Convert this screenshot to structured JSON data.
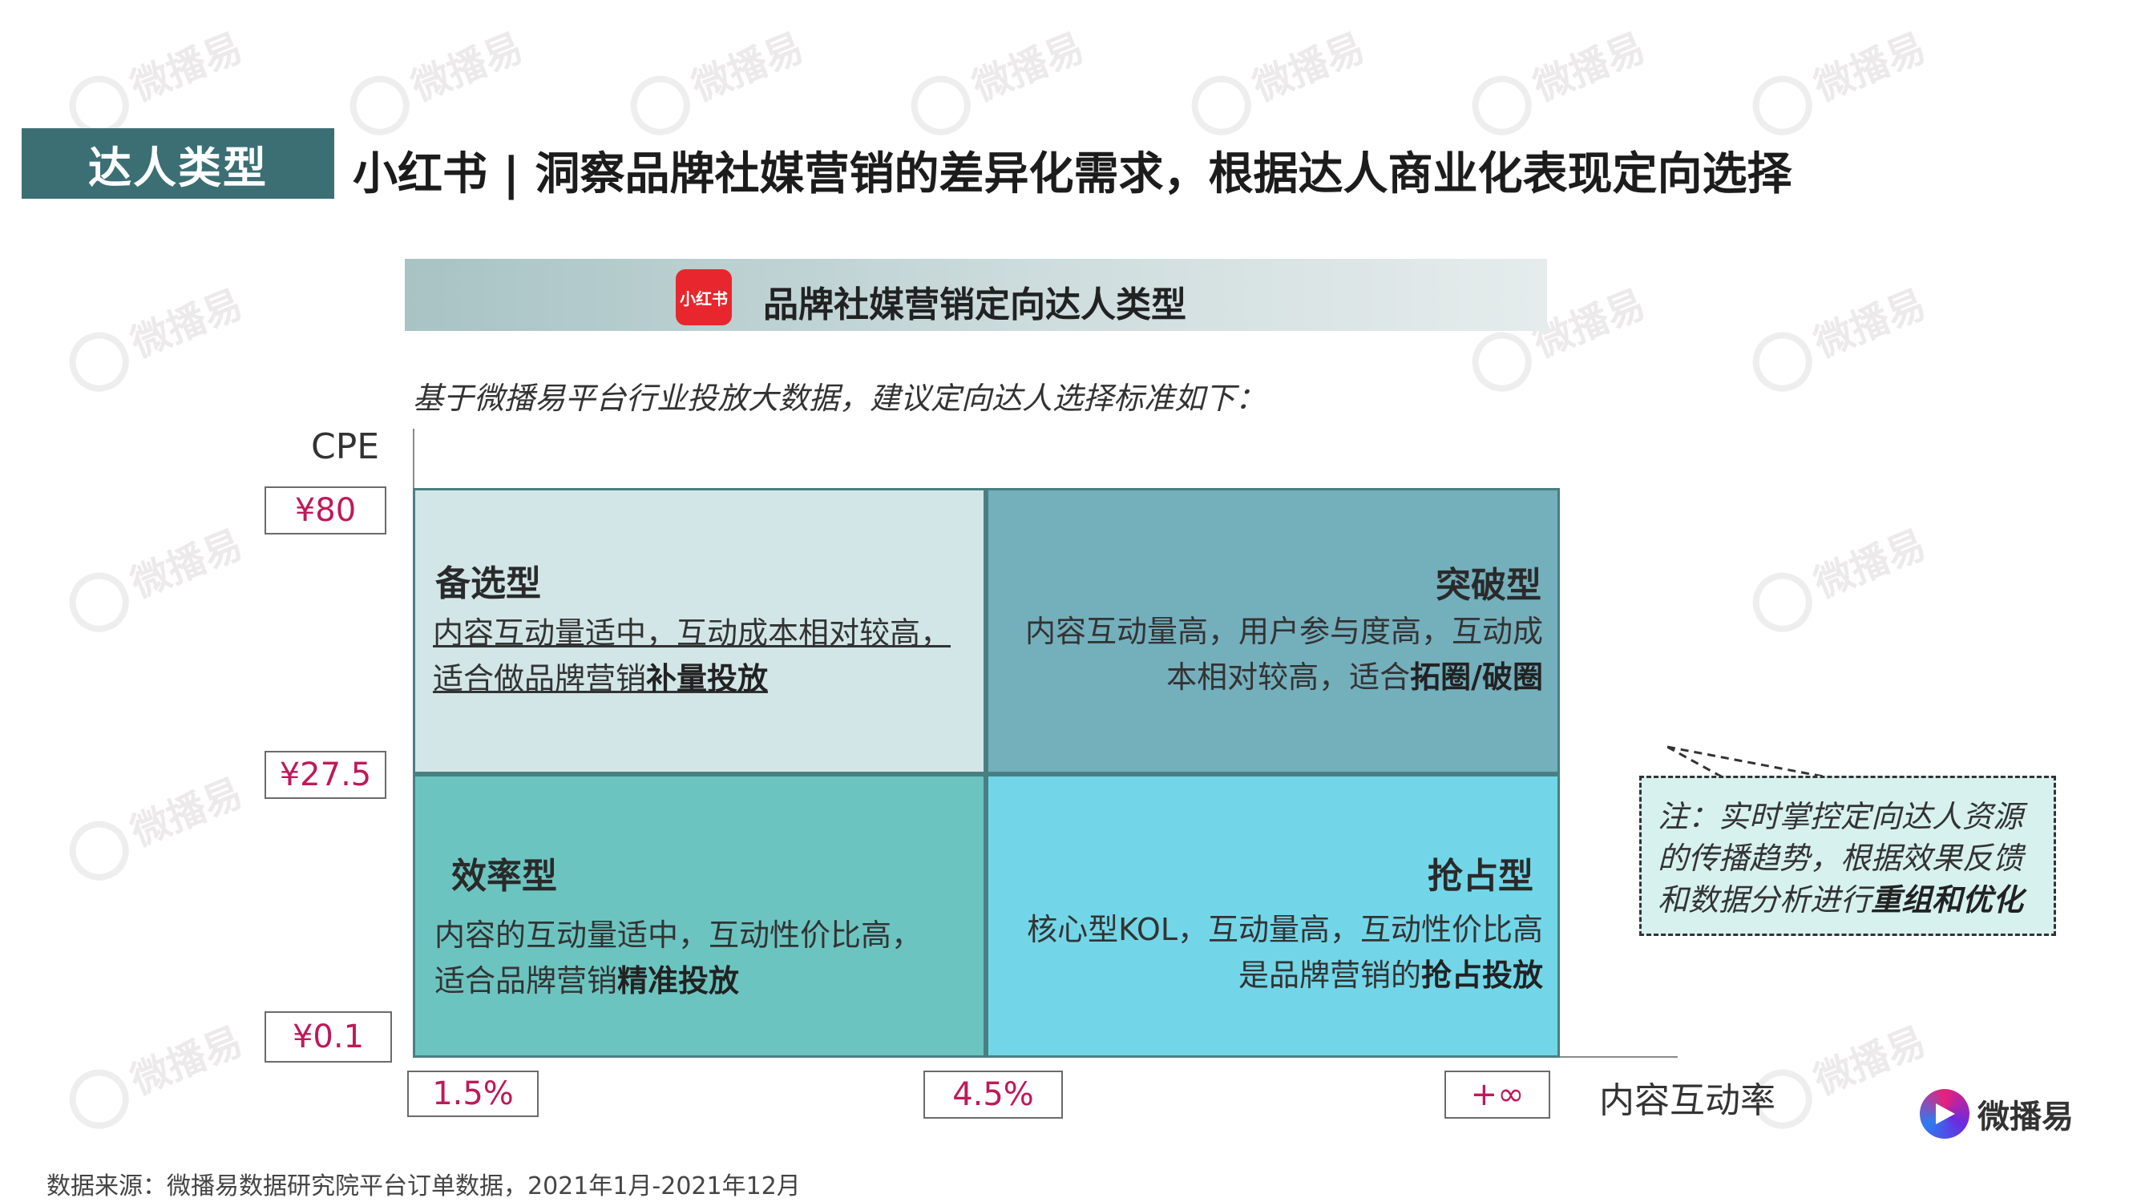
{
  "watermark": "微播易",
  "header": {
    "tag": "达人类型",
    "headline": "小红书 | 洞察品牌社媒营销的差异化需求，根据达人商业化表现定向选择"
  },
  "banner": {
    "logo_text": "小红书",
    "title": "品牌社媒营销定向达人类型"
  },
  "intro": "基于微播易平台行业投放大数据，建议定向达人选择标准如下：",
  "axes": {
    "y_label": "CPE",
    "x_label": "内容互动率",
    "y_ticks": [
      "¥80",
      "¥27.5",
      "¥0.1"
    ],
    "x_ticks": [
      "1.5%",
      "4.5%",
      "+∞"
    ]
  },
  "quadrants": {
    "top_left": {
      "title": "备选型",
      "line1": "内容互动量适中，互动成本相对较高，",
      "line2_prefix": "适合做品牌营销",
      "line2_bold": "补量投放"
    },
    "top_right": {
      "title": "突破型",
      "line1": "内容互动量高，用户参与度高，互动成",
      "line2_prefix": "本相对较高，适合",
      "line2_bold": "拓圈/破圈"
    },
    "bottom_left": {
      "title": "效率型",
      "line1": "内容的互动量适中，互动性价比高，",
      "line2_prefix": "适合品牌营销",
      "line2_bold": "精准投放"
    },
    "bottom_right": {
      "title": "抢占型",
      "line1": "核心型KOL，互动量高，互动性价比高",
      "line2_prefix": "是品牌营销的",
      "line2_bold": "抢占投放"
    }
  },
  "note": {
    "line1": "注：实时掌控定向达人资源",
    "line2": "的传播趋势，根据效果反馈",
    "line3_prefix": "和数据分析进行",
    "line3_bold": "重组和优化"
  },
  "footer": {
    "source": "数据来源：微播易数据研究院平台订单数据，2021年1月-2021年12月",
    "brand": "微播易"
  }
}
